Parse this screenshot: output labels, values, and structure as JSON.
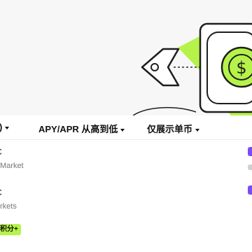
{
  "hero": {
    "currency_icon": "dollar-sign-icon",
    "accent_color": "#b6f34a"
  },
  "filters": {
    "left_fragment": ")",
    "sort_label": "APY/APR 从高到低",
    "currency_label": "仅展示单币"
  },
  "rows": [
    {
      "title": "C",
      "subtitle": "Market"
    },
    {
      "title": "C",
      "subtitle": "rkets"
    }
  ],
  "badge": {
    "label": "积分+"
  },
  "colors": {
    "accent": "#b6f34a",
    "purple": "#7b4cf4",
    "text": "#111111",
    "muted": "#777777"
  }
}
